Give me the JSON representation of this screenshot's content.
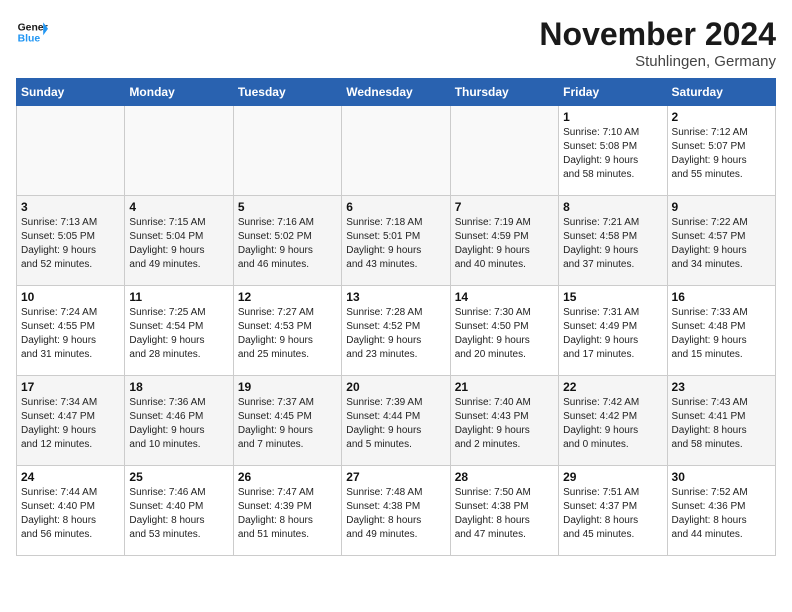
{
  "header": {
    "logo_general": "General",
    "logo_blue": "Blue",
    "month_title": "November 2024",
    "location": "Stuhlingen, Germany"
  },
  "weekdays": [
    "Sunday",
    "Monday",
    "Tuesday",
    "Wednesday",
    "Thursday",
    "Friday",
    "Saturday"
  ],
  "weeks": [
    [
      {
        "day": "",
        "info": ""
      },
      {
        "day": "",
        "info": ""
      },
      {
        "day": "",
        "info": ""
      },
      {
        "day": "",
        "info": ""
      },
      {
        "day": "",
        "info": ""
      },
      {
        "day": "1",
        "info": "Sunrise: 7:10 AM\nSunset: 5:08 PM\nDaylight: 9 hours\nand 58 minutes."
      },
      {
        "day": "2",
        "info": "Sunrise: 7:12 AM\nSunset: 5:07 PM\nDaylight: 9 hours\nand 55 minutes."
      }
    ],
    [
      {
        "day": "3",
        "info": "Sunrise: 7:13 AM\nSunset: 5:05 PM\nDaylight: 9 hours\nand 52 minutes."
      },
      {
        "day": "4",
        "info": "Sunrise: 7:15 AM\nSunset: 5:04 PM\nDaylight: 9 hours\nand 49 minutes."
      },
      {
        "day": "5",
        "info": "Sunrise: 7:16 AM\nSunset: 5:02 PM\nDaylight: 9 hours\nand 46 minutes."
      },
      {
        "day": "6",
        "info": "Sunrise: 7:18 AM\nSunset: 5:01 PM\nDaylight: 9 hours\nand 43 minutes."
      },
      {
        "day": "7",
        "info": "Sunrise: 7:19 AM\nSunset: 4:59 PM\nDaylight: 9 hours\nand 40 minutes."
      },
      {
        "day": "8",
        "info": "Sunrise: 7:21 AM\nSunset: 4:58 PM\nDaylight: 9 hours\nand 37 minutes."
      },
      {
        "day": "9",
        "info": "Sunrise: 7:22 AM\nSunset: 4:57 PM\nDaylight: 9 hours\nand 34 minutes."
      }
    ],
    [
      {
        "day": "10",
        "info": "Sunrise: 7:24 AM\nSunset: 4:55 PM\nDaylight: 9 hours\nand 31 minutes."
      },
      {
        "day": "11",
        "info": "Sunrise: 7:25 AM\nSunset: 4:54 PM\nDaylight: 9 hours\nand 28 minutes."
      },
      {
        "day": "12",
        "info": "Sunrise: 7:27 AM\nSunset: 4:53 PM\nDaylight: 9 hours\nand 25 minutes."
      },
      {
        "day": "13",
        "info": "Sunrise: 7:28 AM\nSunset: 4:52 PM\nDaylight: 9 hours\nand 23 minutes."
      },
      {
        "day": "14",
        "info": "Sunrise: 7:30 AM\nSunset: 4:50 PM\nDaylight: 9 hours\nand 20 minutes."
      },
      {
        "day": "15",
        "info": "Sunrise: 7:31 AM\nSunset: 4:49 PM\nDaylight: 9 hours\nand 17 minutes."
      },
      {
        "day": "16",
        "info": "Sunrise: 7:33 AM\nSunset: 4:48 PM\nDaylight: 9 hours\nand 15 minutes."
      }
    ],
    [
      {
        "day": "17",
        "info": "Sunrise: 7:34 AM\nSunset: 4:47 PM\nDaylight: 9 hours\nand 12 minutes."
      },
      {
        "day": "18",
        "info": "Sunrise: 7:36 AM\nSunset: 4:46 PM\nDaylight: 9 hours\nand 10 minutes."
      },
      {
        "day": "19",
        "info": "Sunrise: 7:37 AM\nSunset: 4:45 PM\nDaylight: 9 hours\nand 7 minutes."
      },
      {
        "day": "20",
        "info": "Sunrise: 7:39 AM\nSunset: 4:44 PM\nDaylight: 9 hours\nand 5 minutes."
      },
      {
        "day": "21",
        "info": "Sunrise: 7:40 AM\nSunset: 4:43 PM\nDaylight: 9 hours\nand 2 minutes."
      },
      {
        "day": "22",
        "info": "Sunrise: 7:42 AM\nSunset: 4:42 PM\nDaylight: 9 hours\nand 0 minutes."
      },
      {
        "day": "23",
        "info": "Sunrise: 7:43 AM\nSunset: 4:41 PM\nDaylight: 8 hours\nand 58 minutes."
      }
    ],
    [
      {
        "day": "24",
        "info": "Sunrise: 7:44 AM\nSunset: 4:40 PM\nDaylight: 8 hours\nand 56 minutes."
      },
      {
        "day": "25",
        "info": "Sunrise: 7:46 AM\nSunset: 4:40 PM\nDaylight: 8 hours\nand 53 minutes."
      },
      {
        "day": "26",
        "info": "Sunrise: 7:47 AM\nSunset: 4:39 PM\nDaylight: 8 hours\nand 51 minutes."
      },
      {
        "day": "27",
        "info": "Sunrise: 7:48 AM\nSunset: 4:38 PM\nDaylight: 8 hours\nand 49 minutes."
      },
      {
        "day": "28",
        "info": "Sunrise: 7:50 AM\nSunset: 4:38 PM\nDaylight: 8 hours\nand 47 minutes."
      },
      {
        "day": "29",
        "info": "Sunrise: 7:51 AM\nSunset: 4:37 PM\nDaylight: 8 hours\nand 45 minutes."
      },
      {
        "day": "30",
        "info": "Sunrise: 7:52 AM\nSunset: 4:36 PM\nDaylight: 8 hours\nand 44 minutes."
      }
    ]
  ]
}
